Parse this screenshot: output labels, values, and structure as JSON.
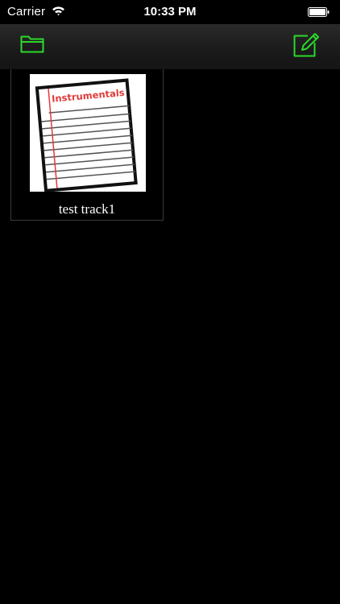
{
  "status_bar": {
    "carrier": "Carrier",
    "time": "10:33 PM"
  },
  "nav_bar": {
    "left_icon": "folder-icon",
    "right_icon": "compose-icon",
    "accent_color": "#2bd92b"
  },
  "tracks": [
    {
      "thumbnail_heading": "Instrumentals",
      "label": "test track1"
    }
  ]
}
